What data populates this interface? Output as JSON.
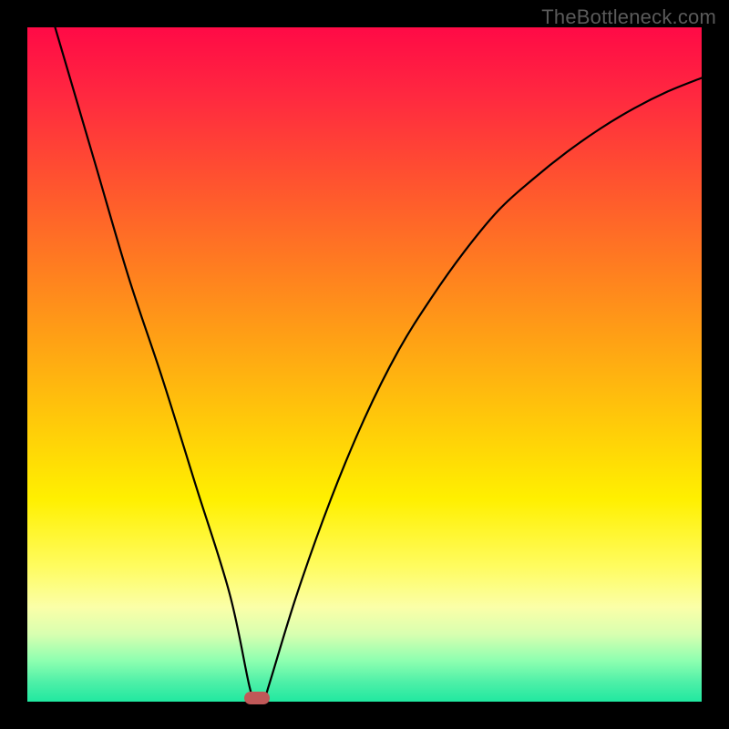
{
  "watermark": "TheBottleneck.com",
  "chart_data": {
    "type": "line",
    "title": "",
    "xlabel": "",
    "ylabel": "",
    "xlim": [
      0,
      100
    ],
    "ylim": [
      0,
      100
    ],
    "series": [
      {
        "name": "bottleneck-curve",
        "x": [
          0,
          5,
          10,
          15,
          20,
          25,
          30,
          33,
          34,
          35,
          36,
          40,
          45,
          50,
          55,
          60,
          65,
          70,
          75,
          80,
          85,
          90,
          95,
          100
        ],
        "values": [
          114,
          97,
          80,
          63,
          48,
          32,
          16,
          2,
          0,
          0,
          3,
          16,
          30,
          42,
          52,
          60,
          67,
          73,
          77.5,
          81.5,
          85,
          88,
          90.5,
          92.5
        ]
      }
    ],
    "marker": {
      "x": 34,
      "y": 0.5,
      "color": "#c05858"
    },
    "background_gradient": {
      "top": "#ff0a46",
      "mid": "#fff000",
      "bottom": "#20e8a0"
    }
  }
}
